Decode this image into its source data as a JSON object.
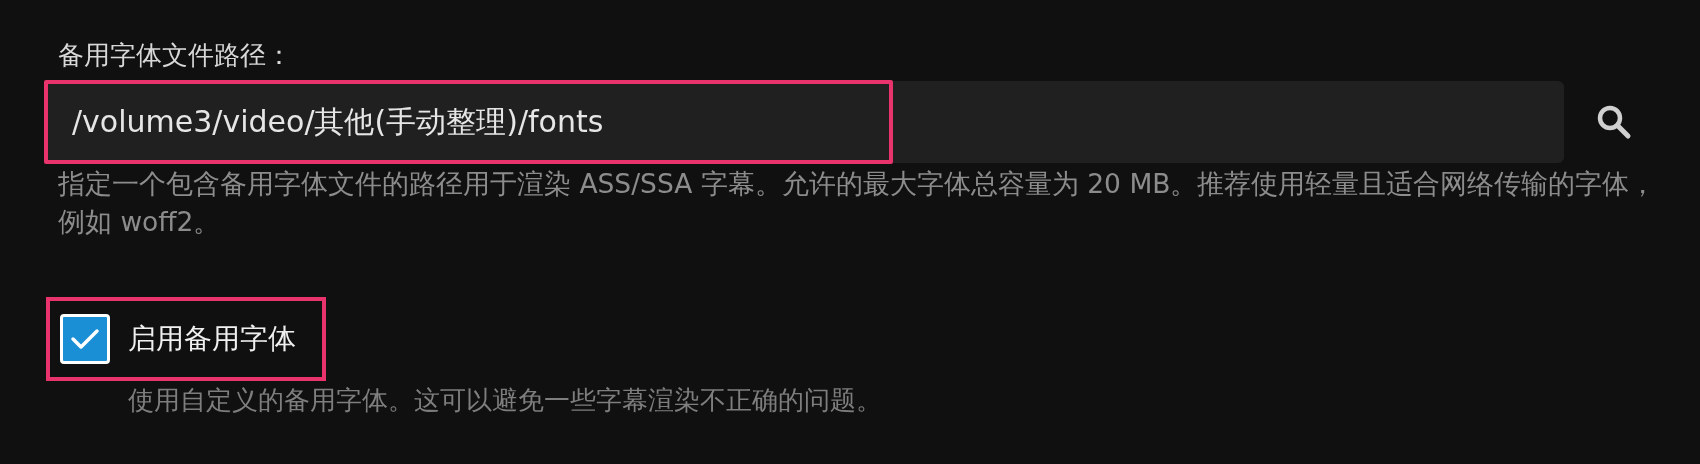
{
  "label": "备用字体文件路径：",
  "path_field": {
    "value": "/volume3/video/其他(手动整理)/fonts",
    "highlighted": true
  },
  "help_text": "指定一个包含备用字体文件的路径用于渲染 ASS/SSA 字幕。允许的最大字体总容量为 20 MB。推荐使用轻量且适合网络传输的字体，例如 woff2。",
  "fallback_checkbox": {
    "label": "启用备用字体",
    "checked": true,
    "highlighted": true
  },
  "checkbox_description": "使用自定义的备用字体。这可以避免一些字幕渲染不正确的问题。"
}
